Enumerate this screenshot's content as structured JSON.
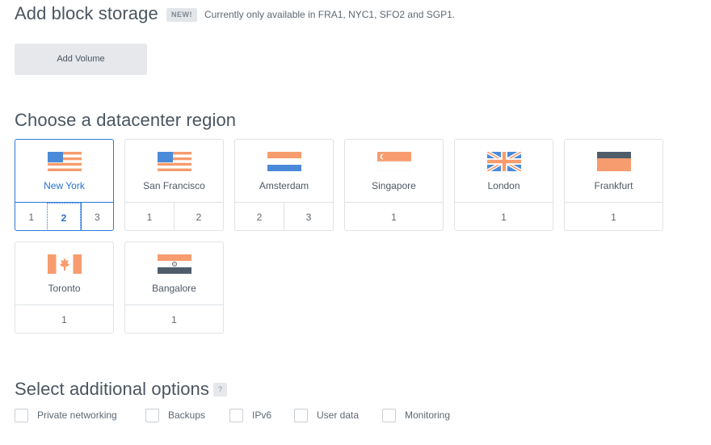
{
  "block_storage": {
    "title": "Add block storage",
    "badge": "NEW!",
    "note": "Currently only available in FRA1, NYC1, SFO2 and SGP1.",
    "button_label": "Add Volume"
  },
  "region": {
    "title": "Choose a datacenter region",
    "selected_city": "New York",
    "selected_datacenter": "2",
    "cards": [
      {
        "city": "New York",
        "flag": "usa-flag-icon",
        "datacenters": [
          "1",
          "2",
          "3"
        ]
      },
      {
        "city": "San Francisco",
        "flag": "usa-flag-icon",
        "datacenters": [
          "1",
          "2"
        ]
      },
      {
        "city": "Amsterdam",
        "flag": "netherlands-flag-icon",
        "datacenters": [
          "2",
          "3"
        ]
      },
      {
        "city": "Singapore",
        "flag": "singapore-flag-icon",
        "datacenters": [
          "1"
        ]
      },
      {
        "city": "London",
        "flag": "uk-flag-icon",
        "datacenters": [
          "1"
        ]
      },
      {
        "city": "Frankfurt",
        "flag": "germany-flag-icon",
        "datacenters": [
          "1"
        ]
      },
      {
        "city": "Toronto",
        "flag": "canada-flag-icon",
        "datacenters": [
          "1"
        ]
      },
      {
        "city": "Bangalore",
        "flag": "india-flag-icon",
        "datacenters": [
          "1"
        ]
      }
    ]
  },
  "options": {
    "title": "Select additional options",
    "help": "?",
    "items": [
      {
        "label": "Private networking",
        "checked": false
      },
      {
        "label": "Backups",
        "checked": false
      },
      {
        "label": "IPv6",
        "checked": false
      },
      {
        "label": "User data",
        "checked": false
      },
      {
        "label": "Monitoring",
        "checked": false
      }
    ]
  },
  "colors": {
    "accent_blue": "#2b7ad9",
    "flag_orange": "#f79c6e",
    "flag_blue": "#4a8ad9",
    "flag_dark": "#4f5d6b"
  }
}
